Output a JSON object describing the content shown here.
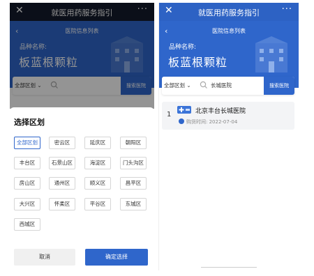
{
  "left_screen": {
    "navbar": {
      "title": "就医用药服务指引",
      "close_icon": "close-icon",
      "more_icon": "more-icon"
    },
    "header": {
      "subtitle": "医院信息列表",
      "variety_label": "品种名称:",
      "variety_name": "板蓝根颗粒"
    },
    "search": {
      "region": "全部区划",
      "query": "",
      "button": "搜索医院"
    },
    "region_sheet": {
      "title": "选择区划",
      "selected": "全部区划",
      "districts": [
        "全部区划",
        "密云区",
        "延庆区",
        "朝阳区",
        "丰台区",
        "石景山区",
        "海淀区",
        "门头沟区",
        "房山区",
        "通州区",
        "顺义区",
        "昌平区",
        "大兴区",
        "怀柔区",
        "平谷区",
        "东城区",
        "西城区"
      ],
      "cancel": "取消",
      "confirm": "确定选择"
    }
  },
  "right_screen": {
    "navbar": {
      "title": "就医用药服务指引",
      "close_icon": "close-icon",
      "more_icon": "more-icon"
    },
    "header": {
      "subtitle": "医院信息列表",
      "variety_label": "品种名称:",
      "variety_name": "板蓝根颗粒"
    },
    "search": {
      "region": "全部区划",
      "query": "长城医院",
      "button": "搜索医院"
    },
    "results": [
      {
        "index": "1",
        "name": "北京丰台长城医院",
        "purchase_label": "购货时间:",
        "purchase_date": "2022-07-04"
      }
    ]
  },
  "colors": {
    "primary": "#2f66cb",
    "navbar_dark": "#141a2b"
  }
}
